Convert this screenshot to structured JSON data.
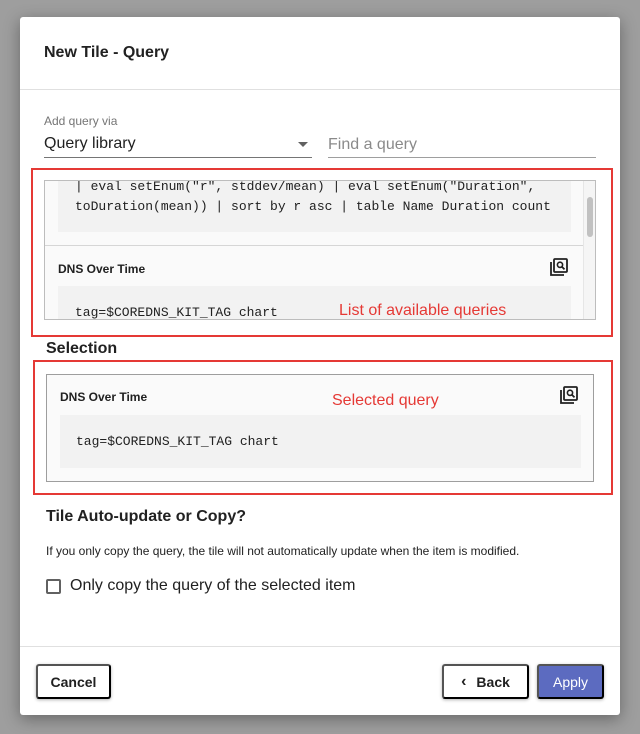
{
  "dialog": {
    "title": "New Tile - Query"
  },
  "add_query": {
    "label": "Add query via",
    "selected": "Query library",
    "find_placeholder": "Find a query"
  },
  "library": {
    "first_query_code": "| eval setEnum(\"r\", stddev/mean) | eval setEnum(\"Duration\",\ntoDuration(mean)) | sort by r asc | table Name Duration count",
    "second_query": {
      "title": "DNS Over Time",
      "code": "tag=$COREDNS_KIT_TAG chart"
    }
  },
  "annotations": {
    "available": "List of available queries",
    "selected": "Selected query",
    "color": "#e53935"
  },
  "selection": {
    "heading": "Selection",
    "title": "DNS Over Time",
    "code": "tag=$COREDNS_KIT_TAG chart"
  },
  "auto_update": {
    "heading": "Tile Auto-update or Copy?",
    "info": "If you only copy the query, the tile will not automatically update when the item is modified.",
    "checkbox_label": "Only copy the query of the selected item",
    "checked": false
  },
  "footer": {
    "cancel": "Cancel",
    "back": "Back",
    "apply": "Apply",
    "apply_color": "#5c6bc0"
  }
}
